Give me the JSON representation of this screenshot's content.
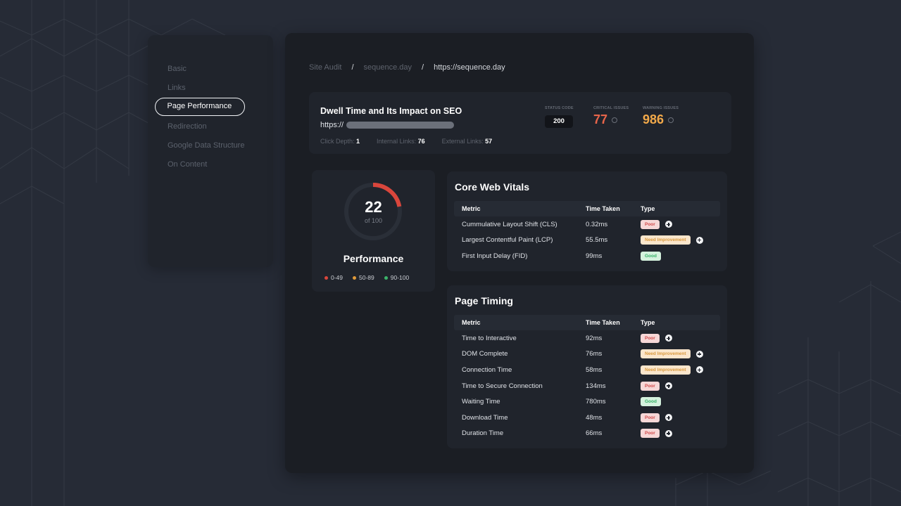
{
  "sidebar": {
    "items": [
      {
        "label": "Basic",
        "active": false
      },
      {
        "label": "Links",
        "active": false
      },
      {
        "label": "Page Performance",
        "active": true
      },
      {
        "label": "Redirection",
        "active": false
      },
      {
        "label": "Google Data Structure",
        "active": false
      },
      {
        "label": "On Content",
        "active": false
      }
    ]
  },
  "breadcrumb": {
    "items": [
      "Site Audit",
      "sequence.day",
      "https://sequence.day"
    ],
    "separator": "/"
  },
  "page": {
    "title": "Dwell Time and Its Impact on SEO",
    "url_prefix": "https://",
    "click_depth_label": "Click Depth:",
    "click_depth": "1",
    "internal_links_label": "Internal Links:",
    "internal_links": "76",
    "external_links_label": "External Links:",
    "external_links": "57",
    "stats": {
      "status_code_label": "STATUS CODE",
      "status_code": "200",
      "critical_label": "CRITICAL ISSUES",
      "critical": "77",
      "warning_label": "WARNING ISSUES",
      "warning": "986"
    }
  },
  "performance": {
    "score": "22",
    "score_value": 22,
    "max": 100,
    "score_sub": "of 100",
    "title": "Performance",
    "legend": [
      {
        "label": "0-49",
        "color": "#d9463c"
      },
      {
        "label": "50-89",
        "color": "#e09a3a"
      },
      {
        "label": "90-100",
        "color": "#3bb46a"
      }
    ]
  },
  "colors": {
    "poor": "#d9463c",
    "critical": "#e8654a",
    "warning": "#f2a94a",
    "track": "#2a2f38"
  },
  "core_web_vitals": {
    "title": "Core Web Vitals",
    "headers": [
      "Metric",
      "Time Taken",
      "Type"
    ],
    "rows": [
      {
        "metric": "Cummulative Layout Shift (CLS)",
        "time": "0.32ms",
        "type": "Poor",
        "kind": "poor",
        "plus": true
      },
      {
        "metric": "Largest Contentful Paint (LCP)",
        "time": "55.5ms",
        "type": "Need Improvement",
        "kind": "need",
        "plus": true
      },
      {
        "metric": "First Input Delay (FID)",
        "time": "99ms",
        "type": "Good",
        "kind": "good",
        "plus": false
      }
    ]
  },
  "page_timing": {
    "title": "Page Timing",
    "headers": [
      "Metric",
      "Time Taken",
      "Type"
    ],
    "rows": [
      {
        "metric": "Time to Interactive",
        "time": "92ms",
        "type": "Poor",
        "kind": "poor",
        "plus": true
      },
      {
        "metric": "DOM Complete",
        "time": "76ms",
        "type": "Need Improvement",
        "kind": "need",
        "plus": true
      },
      {
        "metric": "Connection Time",
        "time": "58ms",
        "type": "Need Improvement",
        "kind": "need",
        "plus": true
      },
      {
        "metric": "Time to Secure Connection",
        "time": "134ms",
        "type": "Poor",
        "kind": "poor",
        "plus": true
      },
      {
        "metric": "Waiting Time",
        "time": "780ms",
        "type": "Good",
        "kind": "good",
        "plus": false
      },
      {
        "metric": "Download Time",
        "time": "48ms",
        "type": "Poor",
        "kind": "poor",
        "plus": true
      },
      {
        "metric": "Duration Time",
        "time": "66ms",
        "type": "Poor",
        "kind": "poor",
        "plus": true
      }
    ]
  }
}
